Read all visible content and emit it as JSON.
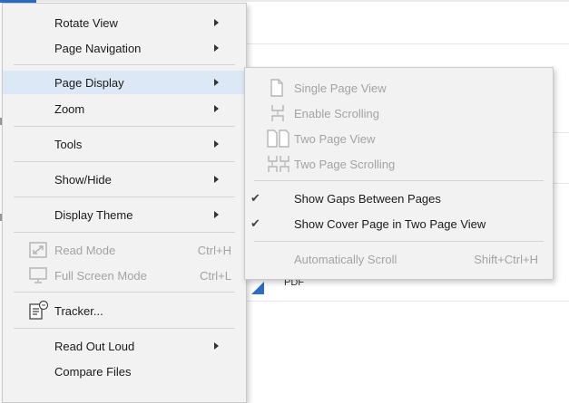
{
  "main_menu": {
    "items": [
      {
        "label": "Rotate View",
        "has_submenu": true
      },
      {
        "label": "Page Navigation",
        "has_submenu": true
      },
      {
        "label": "Page Display",
        "has_submenu": true,
        "highlighted": true
      },
      {
        "label": "Zoom",
        "has_submenu": true
      },
      {
        "label": "Tools",
        "has_submenu": true
      },
      {
        "label": "Show/Hide",
        "has_submenu": true
      },
      {
        "label": "Display Theme",
        "has_submenu": true
      },
      {
        "label": "Read Mode",
        "shortcut": "Ctrl+H",
        "disabled": true,
        "icon": "read-mode-icon"
      },
      {
        "label": "Full Screen Mode",
        "shortcut": "Ctrl+L",
        "disabled": true,
        "icon": "full-screen-icon"
      },
      {
        "label": "Tracker...",
        "icon": "tracker-icon"
      },
      {
        "label": "Read Out Loud",
        "has_submenu": true
      },
      {
        "label": "Compare Files"
      }
    ]
  },
  "page_display_submenu": {
    "items": [
      {
        "label": "Single Page View",
        "disabled": true,
        "icon": "single-page-icon"
      },
      {
        "label": "Enable Scrolling",
        "disabled": true,
        "icon": "enable-scrolling-icon"
      },
      {
        "label": "Two Page View",
        "disabled": true,
        "icon": "two-page-icon"
      },
      {
        "label": "Two Page Scrolling",
        "disabled": true,
        "icon": "two-page-scrolling-icon"
      },
      {
        "label": "Show Gaps Between Pages",
        "checked": true
      },
      {
        "label": "Show Cover Page in Two Page View",
        "checked": true
      },
      {
        "label": "Automatically Scroll",
        "shortcut": "Shift+Ctrl+H",
        "disabled": true
      }
    ]
  },
  "background": {
    "file_type_label": "PDF"
  },
  "colors": {
    "menu_bg": "#f2f2f2",
    "highlight": "#dce8f5",
    "disabled_text": "#a3a3a3",
    "accent": "#2b6cc4"
  }
}
